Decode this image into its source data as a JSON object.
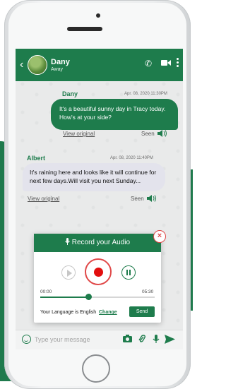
{
  "chat": {
    "contact_name": "Dany",
    "contact_status": "Away"
  },
  "messages": [
    {
      "sender": "Dany",
      "time": "Apr. 08, 2020 11:30PM",
      "text": "It's a beautiful sunny day in Tracy today. How's at your side?",
      "view_original": "View original",
      "seen": "Seen"
    },
    {
      "sender": "Albert",
      "time": "Apr. 08, 2020 11:40PM",
      "text": "It's raining here and looks like it will continue for next few days.Will visit you next Sunday...",
      "view_original": "View original",
      "seen": "Seen"
    }
  ],
  "recorder": {
    "title": "Record your Audio",
    "time_start": "00:00",
    "time_end": "05:30",
    "progress": 0.42,
    "language_text": "Your Language is English",
    "change_label": "Change",
    "send_label": "Send"
  },
  "composer": {
    "placeholder": "Type your message"
  },
  "colors": {
    "brand_green": "#1e7c4c",
    "record_red": "#e20e0e"
  },
  "icons": [
    "back-arrow-icon",
    "phone-icon",
    "video-camera-icon",
    "more-vertical-icon",
    "speaker-icon",
    "microphone-icon",
    "close-icon",
    "play-icon",
    "record-icon",
    "pause-icon",
    "emoji-icon",
    "camera-icon",
    "attachment-icon",
    "send-icon"
  ]
}
